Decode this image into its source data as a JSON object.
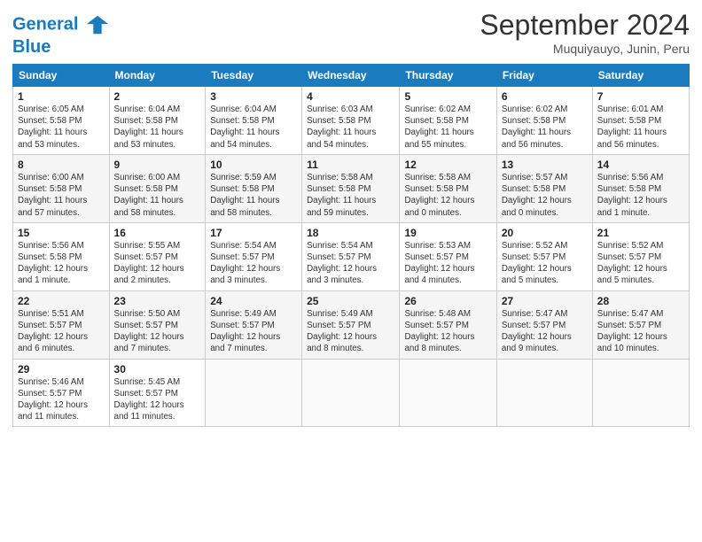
{
  "header": {
    "logo_line1": "General",
    "logo_line2": "Blue",
    "month": "September 2024",
    "location": "Muquiyauyo, Junin, Peru"
  },
  "weekdays": [
    "Sunday",
    "Monday",
    "Tuesday",
    "Wednesday",
    "Thursday",
    "Friday",
    "Saturday"
  ],
  "weeks": [
    [
      {
        "day": "1",
        "info": "Sunrise: 6:05 AM\nSunset: 5:58 PM\nDaylight: 11 hours\nand 53 minutes."
      },
      {
        "day": "2",
        "info": "Sunrise: 6:04 AM\nSunset: 5:58 PM\nDaylight: 11 hours\nand 53 minutes."
      },
      {
        "day": "3",
        "info": "Sunrise: 6:04 AM\nSunset: 5:58 PM\nDaylight: 11 hours\nand 54 minutes."
      },
      {
        "day": "4",
        "info": "Sunrise: 6:03 AM\nSunset: 5:58 PM\nDaylight: 11 hours\nand 54 minutes."
      },
      {
        "day": "5",
        "info": "Sunrise: 6:02 AM\nSunset: 5:58 PM\nDaylight: 11 hours\nand 55 minutes."
      },
      {
        "day": "6",
        "info": "Sunrise: 6:02 AM\nSunset: 5:58 PM\nDaylight: 11 hours\nand 56 minutes."
      },
      {
        "day": "7",
        "info": "Sunrise: 6:01 AM\nSunset: 5:58 PM\nDaylight: 11 hours\nand 56 minutes."
      }
    ],
    [
      {
        "day": "8",
        "info": "Sunrise: 6:00 AM\nSunset: 5:58 PM\nDaylight: 11 hours\nand 57 minutes."
      },
      {
        "day": "9",
        "info": "Sunrise: 6:00 AM\nSunset: 5:58 PM\nDaylight: 11 hours\nand 58 minutes."
      },
      {
        "day": "10",
        "info": "Sunrise: 5:59 AM\nSunset: 5:58 PM\nDaylight: 11 hours\nand 58 minutes."
      },
      {
        "day": "11",
        "info": "Sunrise: 5:58 AM\nSunset: 5:58 PM\nDaylight: 11 hours\nand 59 minutes."
      },
      {
        "day": "12",
        "info": "Sunrise: 5:58 AM\nSunset: 5:58 PM\nDaylight: 12 hours\nand 0 minutes."
      },
      {
        "day": "13",
        "info": "Sunrise: 5:57 AM\nSunset: 5:58 PM\nDaylight: 12 hours\nand 0 minutes."
      },
      {
        "day": "14",
        "info": "Sunrise: 5:56 AM\nSunset: 5:58 PM\nDaylight: 12 hours\nand 1 minute."
      }
    ],
    [
      {
        "day": "15",
        "info": "Sunrise: 5:56 AM\nSunset: 5:58 PM\nDaylight: 12 hours\nand 1 minute."
      },
      {
        "day": "16",
        "info": "Sunrise: 5:55 AM\nSunset: 5:57 PM\nDaylight: 12 hours\nand 2 minutes."
      },
      {
        "day": "17",
        "info": "Sunrise: 5:54 AM\nSunset: 5:57 PM\nDaylight: 12 hours\nand 3 minutes."
      },
      {
        "day": "18",
        "info": "Sunrise: 5:54 AM\nSunset: 5:57 PM\nDaylight: 12 hours\nand 3 minutes."
      },
      {
        "day": "19",
        "info": "Sunrise: 5:53 AM\nSunset: 5:57 PM\nDaylight: 12 hours\nand 4 minutes."
      },
      {
        "day": "20",
        "info": "Sunrise: 5:52 AM\nSunset: 5:57 PM\nDaylight: 12 hours\nand 5 minutes."
      },
      {
        "day": "21",
        "info": "Sunrise: 5:52 AM\nSunset: 5:57 PM\nDaylight: 12 hours\nand 5 minutes."
      }
    ],
    [
      {
        "day": "22",
        "info": "Sunrise: 5:51 AM\nSunset: 5:57 PM\nDaylight: 12 hours\nand 6 minutes."
      },
      {
        "day": "23",
        "info": "Sunrise: 5:50 AM\nSunset: 5:57 PM\nDaylight: 12 hours\nand 7 minutes."
      },
      {
        "day": "24",
        "info": "Sunrise: 5:49 AM\nSunset: 5:57 PM\nDaylight: 12 hours\nand 7 minutes."
      },
      {
        "day": "25",
        "info": "Sunrise: 5:49 AM\nSunset: 5:57 PM\nDaylight: 12 hours\nand 8 minutes."
      },
      {
        "day": "26",
        "info": "Sunrise: 5:48 AM\nSunset: 5:57 PM\nDaylight: 12 hours\nand 8 minutes."
      },
      {
        "day": "27",
        "info": "Sunrise: 5:47 AM\nSunset: 5:57 PM\nDaylight: 12 hours\nand 9 minutes."
      },
      {
        "day": "28",
        "info": "Sunrise: 5:47 AM\nSunset: 5:57 PM\nDaylight: 12 hours\nand 10 minutes."
      }
    ],
    [
      {
        "day": "29",
        "info": "Sunrise: 5:46 AM\nSunset: 5:57 PM\nDaylight: 12 hours\nand 11 minutes."
      },
      {
        "day": "30",
        "info": "Sunrise: 5:45 AM\nSunset: 5:57 PM\nDaylight: 12 hours\nand 11 minutes."
      },
      {
        "day": "",
        "info": ""
      },
      {
        "day": "",
        "info": ""
      },
      {
        "day": "",
        "info": ""
      },
      {
        "day": "",
        "info": ""
      },
      {
        "day": "",
        "info": ""
      }
    ]
  ]
}
